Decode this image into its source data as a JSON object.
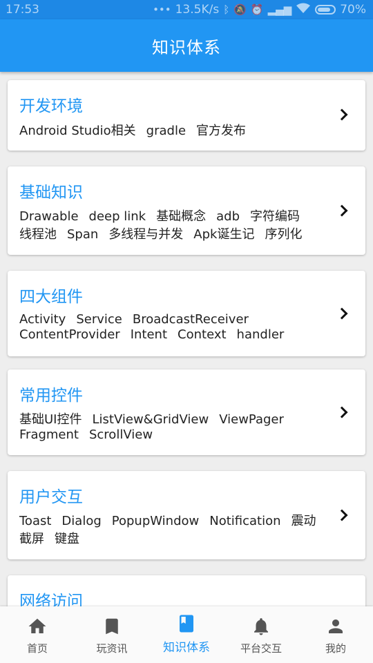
{
  "status_bar": {
    "time": "17:53",
    "network_speed": "13.5K/s",
    "battery": "70%",
    "icons": [
      "more-dots-icon",
      "bluetooth-icon",
      "mute-icon",
      "alarm-icon",
      "signal-icon",
      "wifi-icon",
      "battery-icon"
    ]
  },
  "app_bar": {
    "title": "知识体系"
  },
  "cards": [
    {
      "title": "开发环境",
      "tags": [
        "Android Studio相关",
        "gradle",
        "官方发布"
      ]
    },
    {
      "title": "基础知识",
      "tags": [
        "Drawable",
        "deep link",
        "基础概念",
        "adb",
        "字符编码",
        "线程池",
        "Span",
        "多线程与并发",
        "Apk诞生记",
        "序列化"
      ]
    },
    {
      "title": "四大组件",
      "tags": [
        "Activity",
        "Service",
        "BroadcastReceiver",
        "ContentProvider",
        "Intent",
        "Context",
        "handler"
      ]
    },
    {
      "title": "常用控件",
      "tags": [
        "基础UI控件",
        "ListView&GridView",
        "ViewPager",
        "Fragment",
        "ScrollView"
      ]
    },
    {
      "title": "用户交互",
      "tags": [
        "Toast",
        "Dialog",
        "PopupWindow",
        "Notification",
        "震动",
        "截屏",
        "键盘"
      ]
    },
    {
      "title": "网络访问",
      "tags": []
    }
  ],
  "bottom_nav": {
    "items": [
      {
        "label": "首页",
        "icon": "home-icon"
      },
      {
        "label": "玩资讯",
        "icon": "bookmark-icon"
      },
      {
        "label": "知识体系",
        "icon": "book-icon",
        "active": true
      },
      {
        "label": "平台交互",
        "icon": "bell-icon"
      },
      {
        "label": "我的",
        "icon": "person-icon"
      }
    ]
  },
  "colors": {
    "primary": "#2196F3",
    "status_bar": "#1E88E5",
    "background": "#EEEEEE"
  }
}
